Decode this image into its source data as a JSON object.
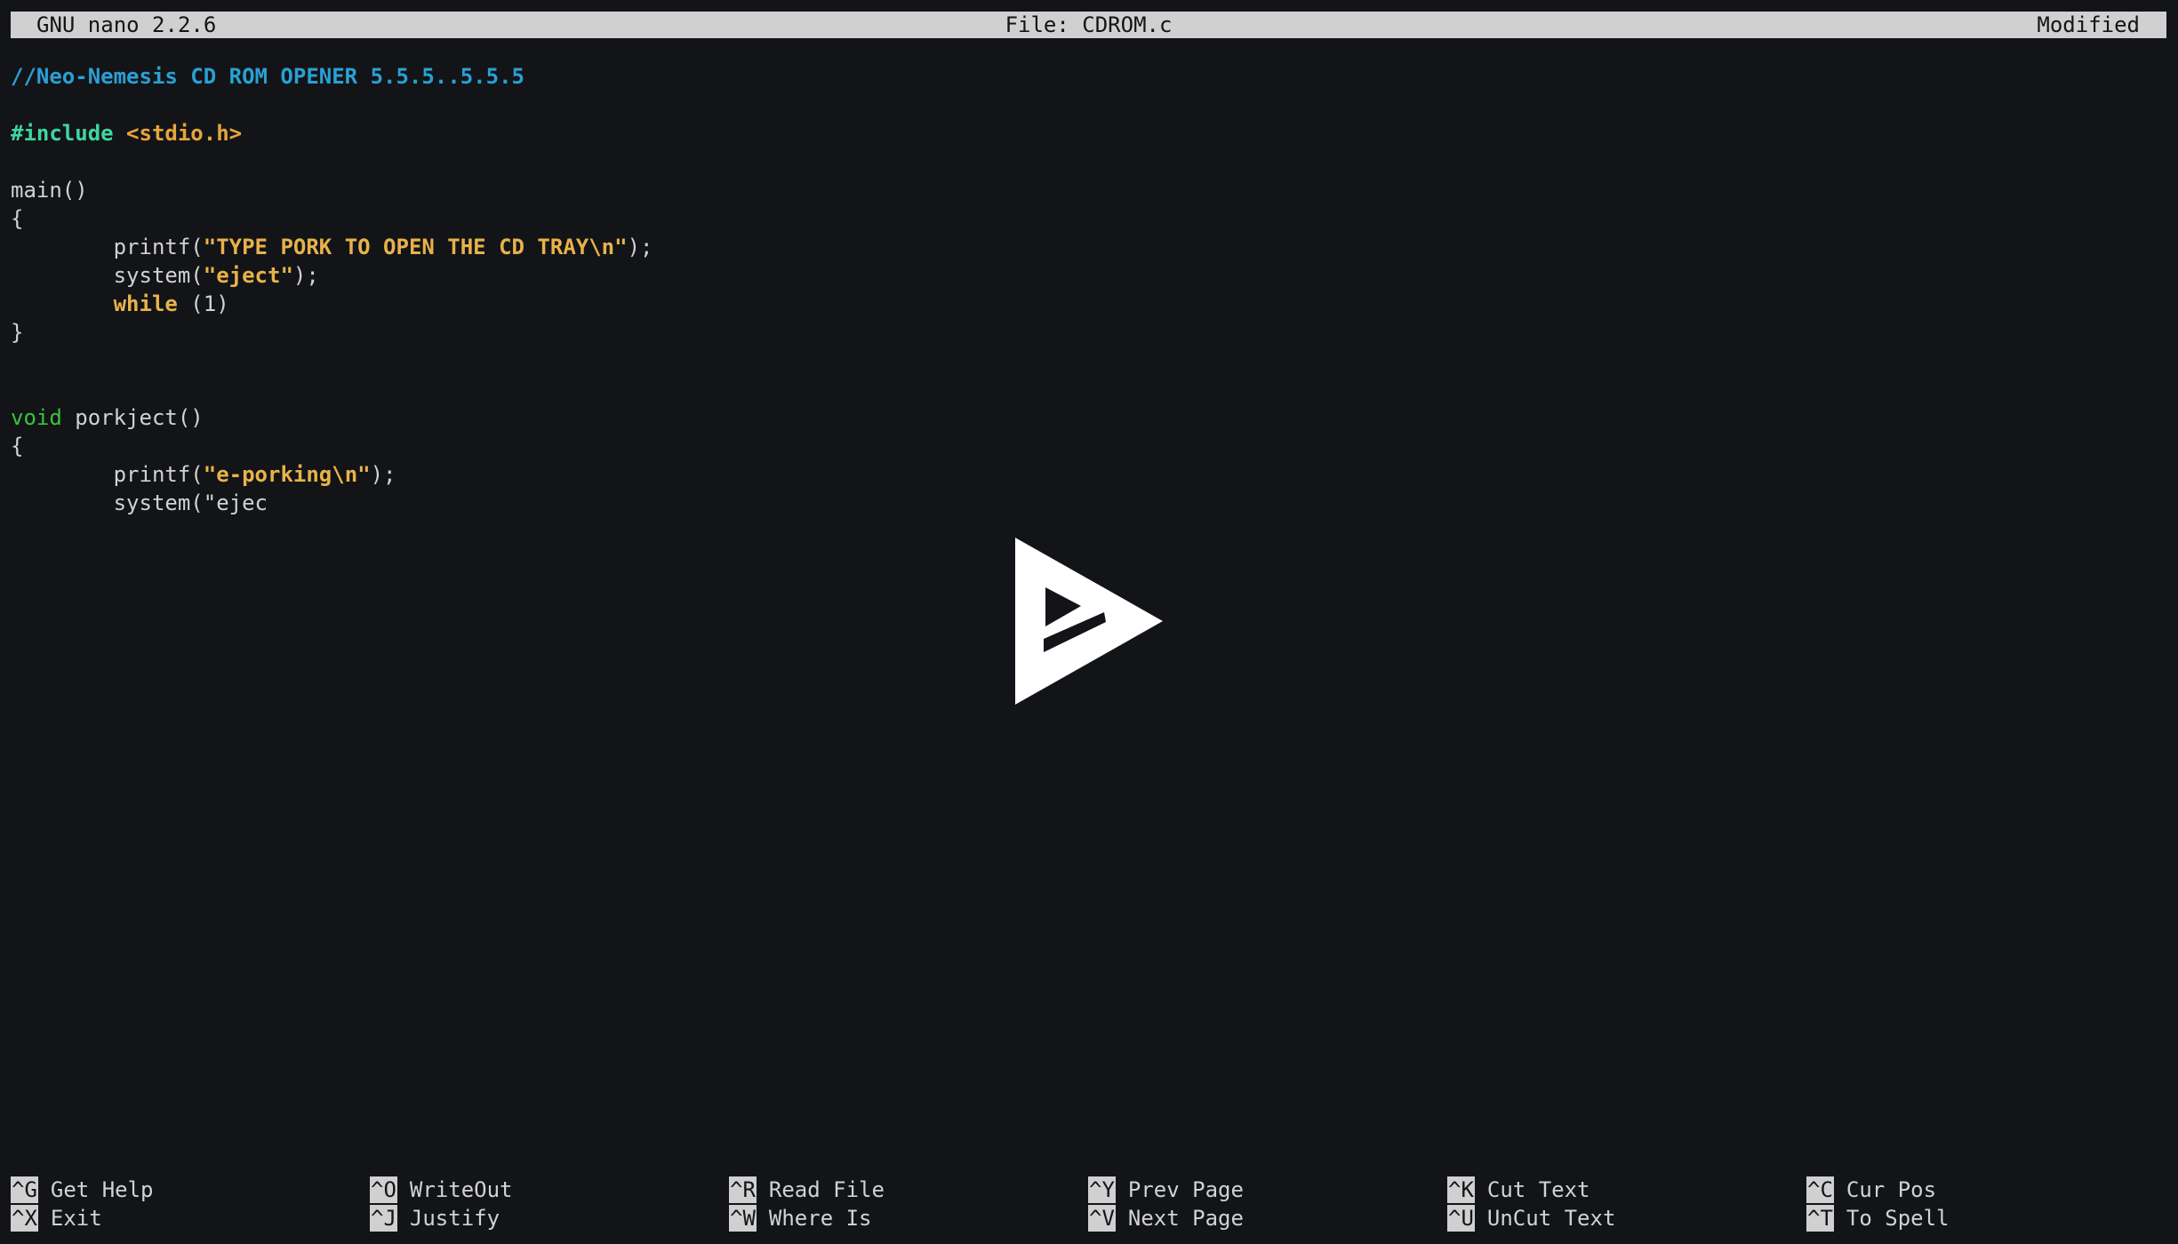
{
  "titlebar": {
    "app": "GNU nano 2.2.6",
    "file": "File: CDROM.c",
    "status": "Modified"
  },
  "code": {
    "comment": "//Neo-Nemesis CD ROM OPENER 5.5.5..5.5.5",
    "include_kw": "#include",
    "include_hdr": "<stdio.h>",
    "main_decl": "main()",
    "open_brace": "{",
    "close_brace": "}",
    "indent": "        ",
    "printf1_pre": "printf(",
    "printf1_str": "\"TYPE PORK TO OPEN THE CD TRAY\\n\"",
    "printf1_post": ");",
    "system1_pre": "system(",
    "system1_str": "\"eject\"",
    "system1_post": ");",
    "while_kw": "while",
    "while_rest": " (1)",
    "void_kw": "void",
    "porkject_decl": " porkject()",
    "printf2_pre": "printf(",
    "printf2_str": "\"e-porking\\n\"",
    "printf2_post": ");",
    "system2_partial": "system(\"ejec"
  },
  "icons": {
    "center": "play-icon"
  },
  "shortcuts": [
    {
      "key": "^G",
      "label": "Get Help"
    },
    {
      "key": "^X",
      "label": "Exit"
    },
    {
      "key": "^O",
      "label": "WriteOut"
    },
    {
      "key": "^J",
      "label": "Justify"
    },
    {
      "key": "^R",
      "label": "Read File"
    },
    {
      "key": "^W",
      "label": "Where Is"
    },
    {
      "key": "^Y",
      "label": "Prev Page"
    },
    {
      "key": "^V",
      "label": "Next Page"
    },
    {
      "key": "^K",
      "label": "Cut Text"
    },
    {
      "key": "^U",
      "label": "UnCut Text"
    },
    {
      "key": "^C",
      "label": "Cur Pos"
    },
    {
      "key": "^T",
      "label": "To Spell"
    }
  ],
  "colors": {
    "background": "#121417",
    "comment": "#2aa0d4",
    "preprocessor": "#3fd6a0",
    "string": "#e8b24a",
    "type": "#3cc23c"
  }
}
